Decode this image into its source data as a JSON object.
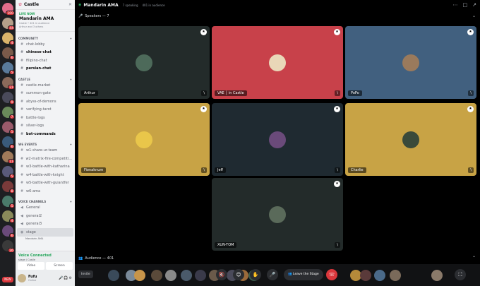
{
  "sidebar": {
    "server_name": "Castle",
    "event": {
      "live": "LIVE NOW",
      "title": "Mandarin AMA",
      "meta": "Castle • 401 in audience",
      "hosts": "Arthur and 3 others"
    },
    "categories": [
      {
        "name": "COMMUNITY",
        "channels": [
          {
            "label": "chat-lobby",
            "icon": "#",
            "unread": false
          },
          {
            "label": "chinese-chat",
            "icon": "#",
            "unread": true
          },
          {
            "label": "filipino-chat",
            "icon": "#",
            "unread": false
          },
          {
            "label": "persian-chat",
            "icon": "#",
            "unread": true
          }
        ]
      },
      {
        "name": "CASTLE",
        "channels": [
          {
            "label": "castle-market",
            "icon": "#",
            "unread": false
          },
          {
            "label": "summon-gate",
            "icon": "#",
            "unread": false
          },
          {
            "label": "abyss-of-demons",
            "icon": "#",
            "unread": false
          },
          {
            "label": "verifying-tarot",
            "icon": "#",
            "unread": false
          },
          {
            "label": "battle-logs",
            "icon": "#",
            "unread": false
          },
          {
            "label": "silver-logs",
            "icon": "#",
            "unread": false
          },
          {
            "label": "bot-commands",
            "icon": "#",
            "unread": true
          }
        ]
      },
      {
        "name": "W6 EVENTS",
        "channels": [
          {
            "label": "w1-share-ur-team",
            "icon": "#",
            "unread": false
          },
          {
            "label": "w2-matrix-fire-competiti...",
            "icon": "#",
            "unread": false
          },
          {
            "label": "w3-battle-with-katharina",
            "icon": "#",
            "unread": false
          },
          {
            "label": "w4-battle-with-knight",
            "icon": "#",
            "unread": false
          },
          {
            "label": "w5-battle-with-guiantfer",
            "icon": "#",
            "unread": false
          },
          {
            "label": "w6-ama",
            "icon": "#",
            "unread": false
          }
        ]
      },
      {
        "name": "VOICE CHANNELS",
        "channels": [
          {
            "label": "General",
            "icon": "◀",
            "unread": false
          },
          {
            "label": "general2",
            "icon": "◀",
            "unread": false
          },
          {
            "label": "general3",
            "icon": "◀",
            "unread": false
          }
        ]
      }
    ],
    "stage_channel": {
      "label": "stage",
      "sub": "Mandarin AMA"
    },
    "voice_status": {
      "title": "Voice Connected",
      "sub": "stage / Castle",
      "video_label": "Video",
      "screen_label": "Screen"
    },
    "user": {
      "name": "Fufu",
      "status": "Online"
    }
  },
  "rail": {
    "badges": [
      "100",
      "44",
      "4",
      "6",
      "5",
      "21",
      "9",
      "7",
      "5",
      "6",
      "11",
      "5",
      "8",
      "5",
      "4",
      "6",
      "26"
    ],
    "new_label": "NEW"
  },
  "stage": {
    "title": "Mandarin AMA",
    "speaking": "7 speaking",
    "audience_count": "401 in audience",
    "speakers_label": "Speakers — 7",
    "audience_label": "Audience — 401",
    "speakers": [
      {
        "name": "Arthur",
        "bg": "#232b2a",
        "av": "#4d6a5a"
      },
      {
        "name": "VAE │ in Castle",
        "bg": "#c8414a",
        "av": "#e9d7b8"
      },
      {
        "name": "PoPo",
        "bg": "#41607f",
        "av": "#9a7a5c"
      },
      {
        "name": "Fionaknum",
        "bg": "#c8a345",
        "av": "#e9c64a"
      },
      {
        "name": "Jeff",
        "bg": "#1f2a31",
        "av": "#6a4a7a"
      },
      {
        "name": "Charlie",
        "bg": "#c8a345",
        "av": "#3a4a3a"
      },
      {
        "name": "XUN-TOM",
        "bg": "#232b2a",
        "av": "#5a6a5a"
      }
    ],
    "controls": {
      "invite": "Invite",
      "leave": "Leave the Stage"
    },
    "audience_avatars": [
      "#3a4a5a",
      "#7a8a9a",
      "#c8954a",
      "#5a4a3a",
      "#8a8a8a",
      "#4a5a6a",
      "#3a3a4a",
      "#6a5a4a",
      "#4a4a5a",
      "#9a6a3a",
      "#3a5a4a",
      "#b58a3a",
      "#5a3a3a",
      "#4a6a8a",
      "#7a6a5a",
      "#8a7a6a"
    ],
    "colors": {
      "accent": "#5865f2",
      "live": "#23a559",
      "danger": "#da373c"
    }
  }
}
